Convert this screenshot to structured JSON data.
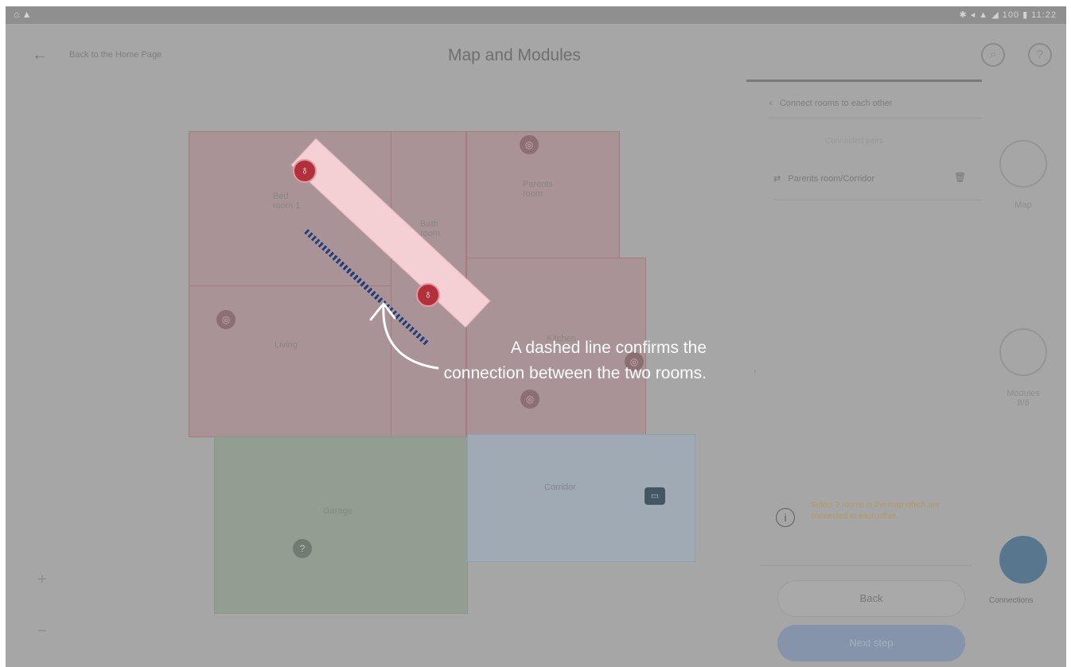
{
  "status_bar": {
    "left_icons": "⌂ ▲",
    "right_text": "✱ ◂ ▲ ◢ 100 ▮ 11:22"
  },
  "header": {
    "back_label": "Back to the Home Page",
    "title": "Map and Modules"
  },
  "map": {
    "rooms": [
      {
        "label": "Bed\nroom 1"
      },
      {
        "label": "Bath\nroom"
      },
      {
        "label": "Corridor"
      },
      {
        "label": "Living"
      },
      {
        "label": "Parents\nroom"
      },
      {
        "label": "Kitchen"
      },
      {
        "label": "Garage"
      }
    ],
    "zoom_in": "+",
    "zoom_out": "−"
  },
  "panel": {
    "heading": "Connect rooms to each other",
    "subheading": "Connected pairs",
    "connection_item": "Parents room/Corridor",
    "info_text": "Select 2 rooms in the map which are connected to each other.",
    "back_button": "Back",
    "next_button": "Next step"
  },
  "side_nav": {
    "map_label": "Map",
    "modules_label": "Modules\n8/8",
    "connections_label": "Connections"
  },
  "callout": {
    "text": "A dashed line confirms the connection between the two rooms."
  },
  "colors": {
    "highlight_fill": "#f4d0d4",
    "bulb_red": "#b22f3c",
    "dash_blue": "#1f3e7a",
    "overlay_gray": "#a6a6a6"
  }
}
